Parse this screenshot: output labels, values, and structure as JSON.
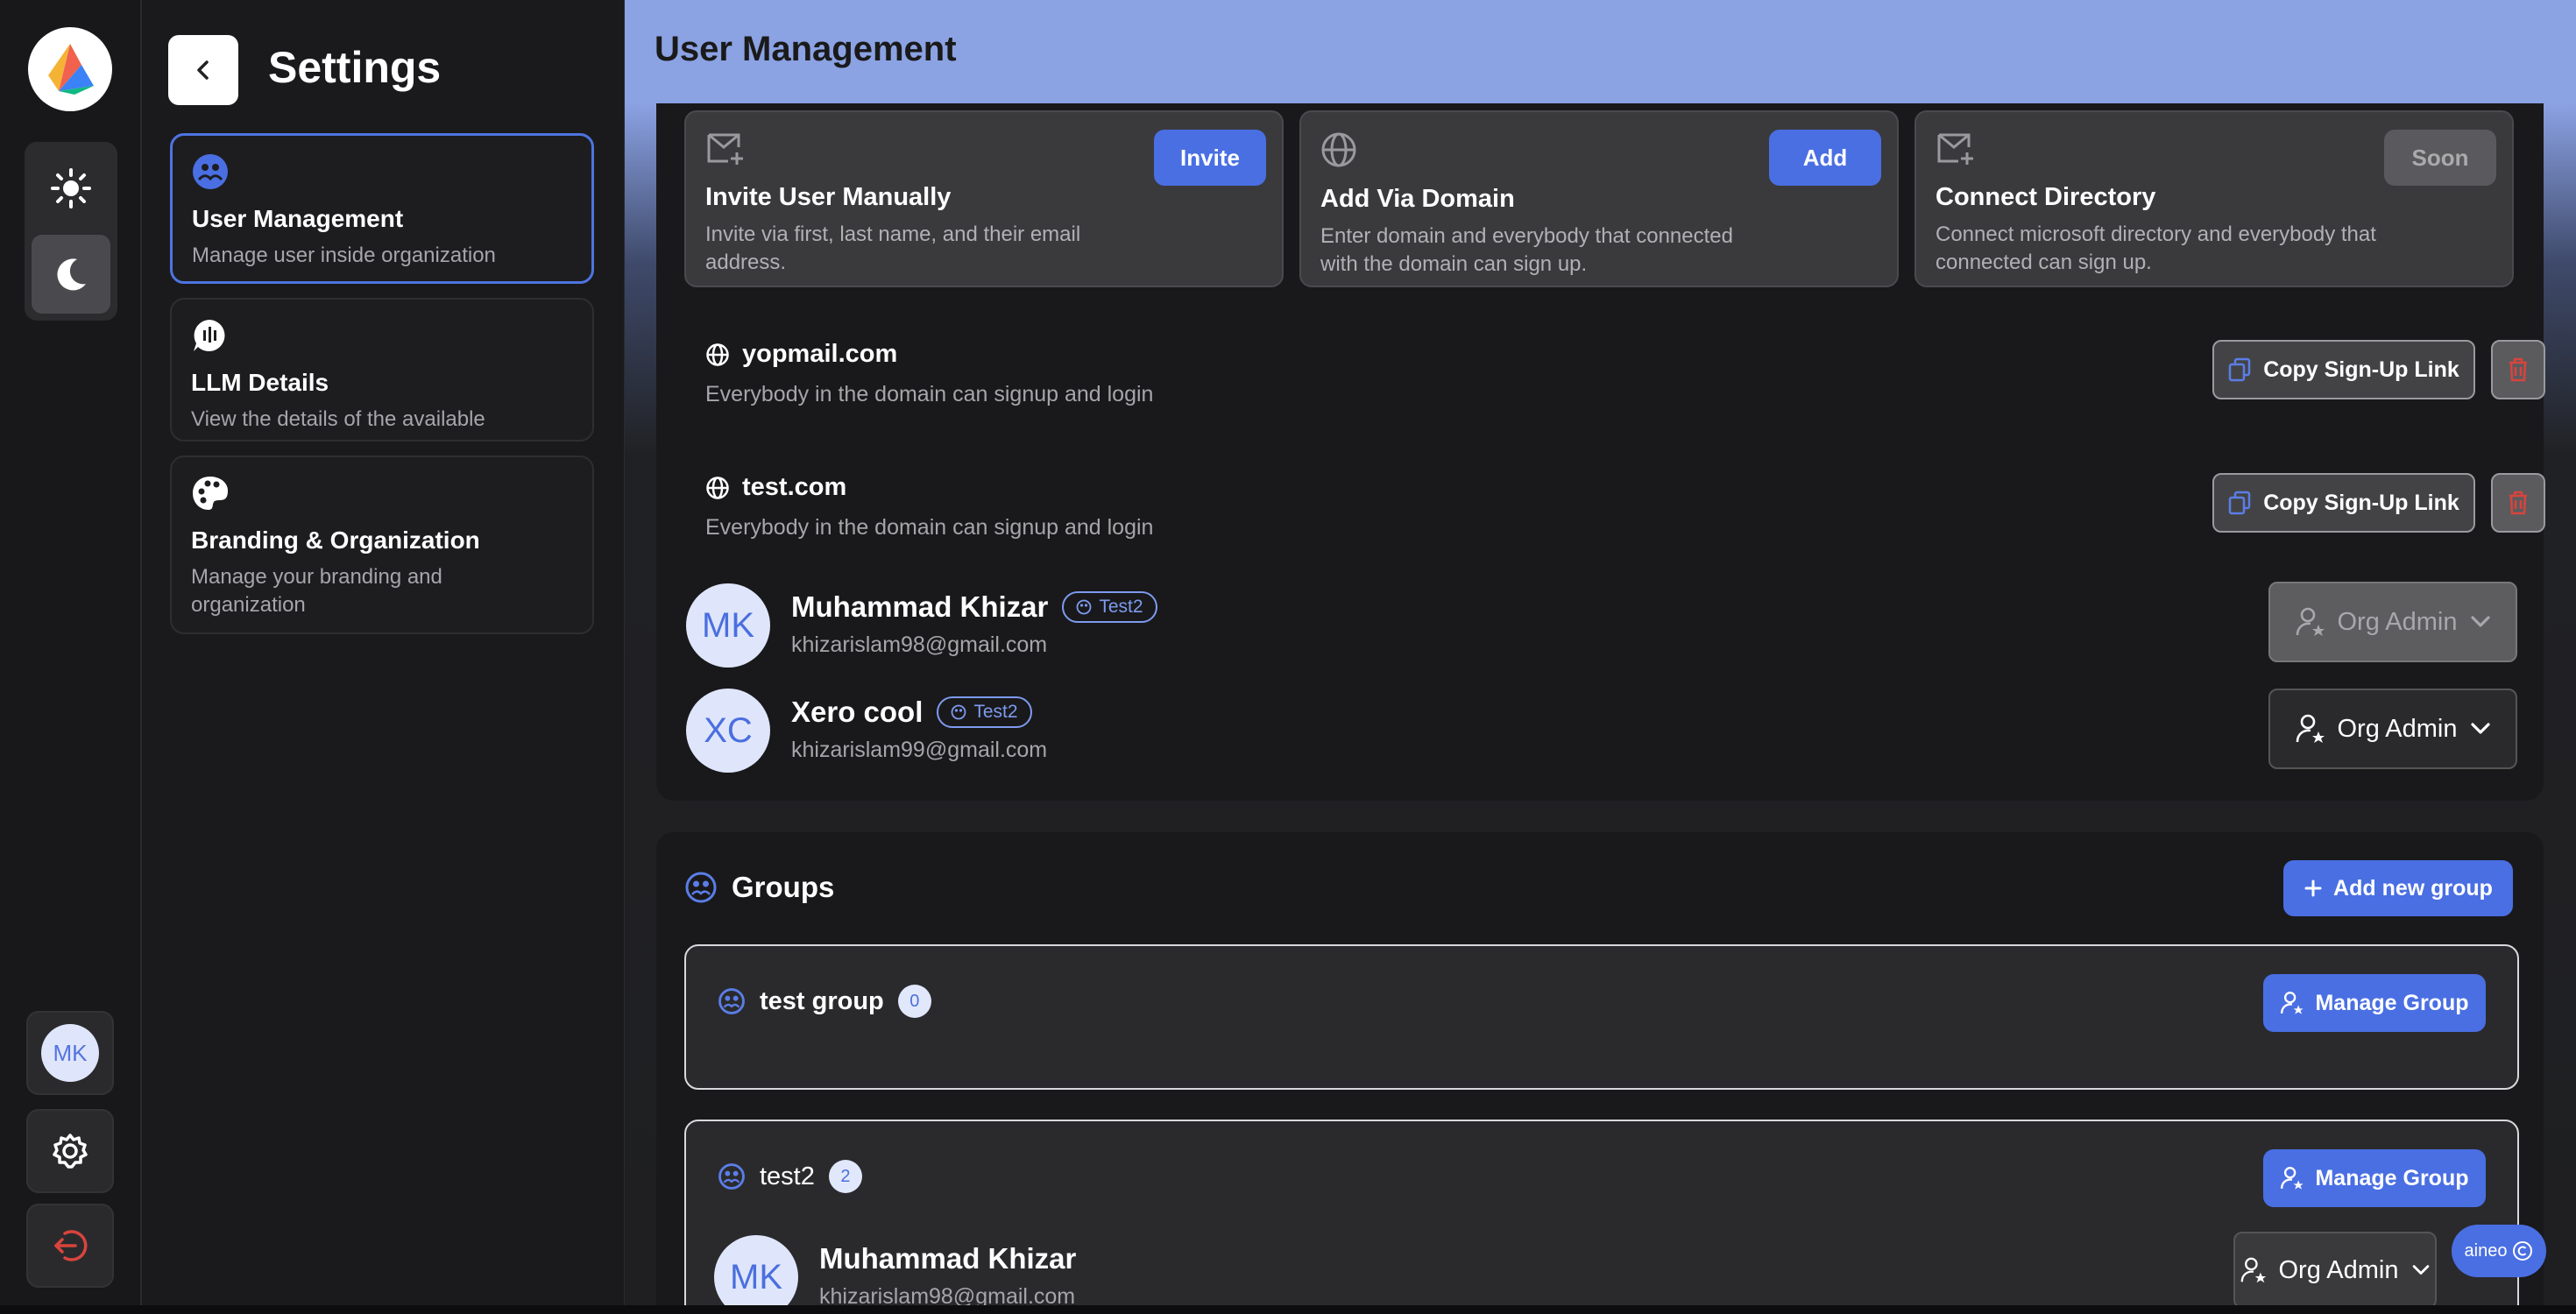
{
  "rail": {
    "avatar_initials": "MK"
  },
  "settings": {
    "title": "Settings",
    "nav": [
      {
        "title": "User Management",
        "desc": "Manage user inside organization"
      },
      {
        "title": "LLM Details",
        "desc": "View the details of the available"
      },
      {
        "title": "Branding & Organization",
        "desc": "Manage your branding and organization"
      }
    ]
  },
  "main": {
    "title": "User Management",
    "options": [
      {
        "title": "Invite User Manually",
        "desc": "Invite via first, last name, and their email address.",
        "button": "Invite"
      },
      {
        "title": "Add Via Domain",
        "desc": "Enter domain and everybody that connected with the domain can sign up.",
        "button": "Add"
      },
      {
        "title": "Connect Directory",
        "desc": "Connect microsoft directory and everybody that connected can sign up.",
        "button": "Soon"
      }
    ],
    "domains": [
      {
        "name": "yopmail.com",
        "desc": "Everybody in the domain can signup and login",
        "copy_label": "Copy Sign-Up Link"
      },
      {
        "name": "test.com",
        "desc": "Everybody in the domain can signup and login",
        "copy_label": "Copy Sign-Up Link"
      }
    ],
    "users": [
      {
        "initials": "MK",
        "name": "Muhammad Khizar",
        "tag": "Test2",
        "email": "khizarislam98@gmail.com",
        "role": "Org Admin"
      },
      {
        "initials": "XC",
        "name": "Xero cool",
        "tag": "Test2",
        "email": "khizarislam99@gmail.com",
        "role": "Org Admin"
      }
    ]
  },
  "groups": {
    "title": "Groups",
    "add_label": "Add new group",
    "items": [
      {
        "name": "test group",
        "count": "0",
        "manage_label": "Manage Group"
      },
      {
        "name": "test2",
        "count": "2",
        "manage_label": "Manage Group",
        "member": {
          "initials": "MK",
          "name": "Muhammad Khizar",
          "email": "khizarislam98@gmail.com",
          "role": "Org Admin"
        }
      }
    ]
  },
  "badge": {
    "label": "aineo"
  },
  "colors": {
    "accent": "#4a6fe3",
    "header": "#8ba2e3",
    "danger": "#d9443c"
  }
}
